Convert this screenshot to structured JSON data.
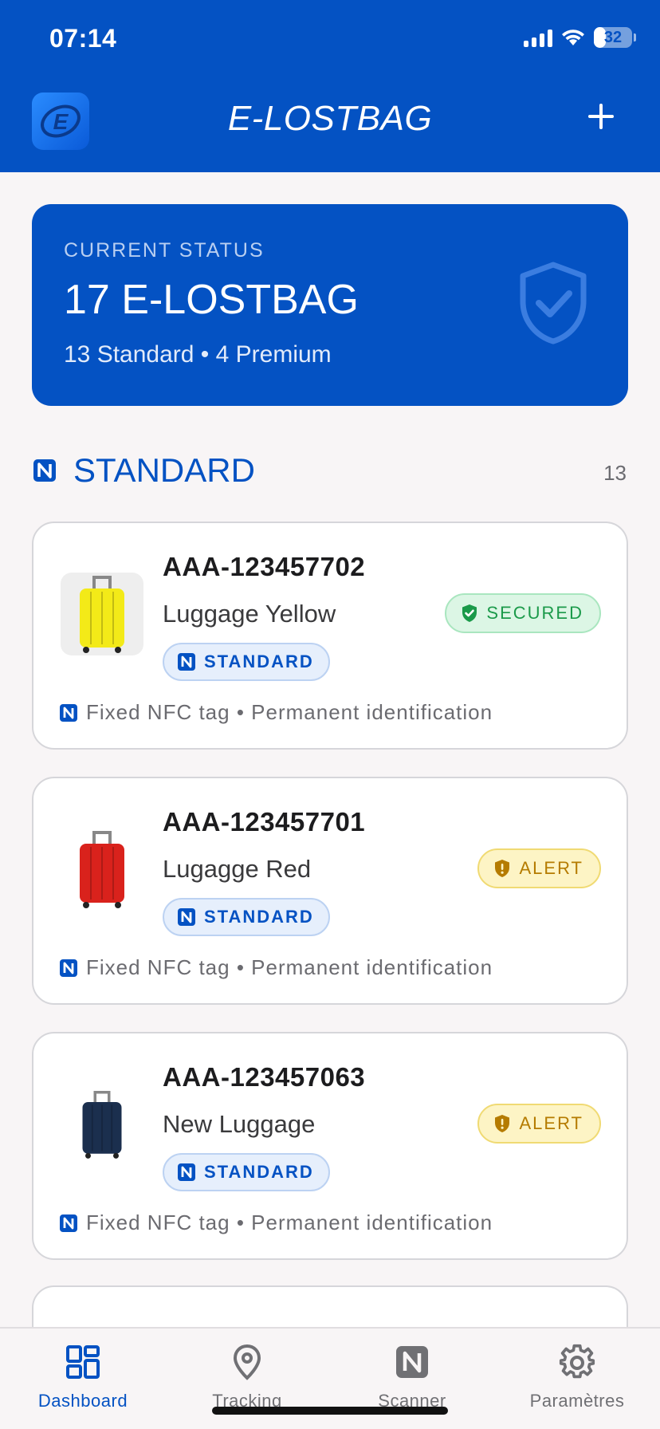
{
  "status_bar": {
    "time": "07:14",
    "battery": "32",
    "battery_level": 0.32
  },
  "header": {
    "title": "E-LOSTBAG",
    "logo_letter": "E"
  },
  "status_card": {
    "label": "CURRENT STATUS",
    "count_text": "17 E-LOSTBAG",
    "breakdown": "13 Standard • 4 Premium"
  },
  "section": {
    "title": "STANDARD",
    "count": "13"
  },
  "items": [
    {
      "code": "AAA-123457702",
      "name": "Luggage Yellow",
      "tier": "STANDARD",
      "status": "SECURED",
      "status_type": "secured",
      "footer": "Fixed NFC tag • Permanent identification",
      "color": "#f3ea18"
    },
    {
      "code": "AAA-123457701",
      "name": "Lugagge Red",
      "tier": "STANDARD",
      "status": "ALERT",
      "status_type": "alert",
      "footer": "Fixed NFC tag • Permanent identification",
      "color": "#d9221c"
    },
    {
      "code": "AAA-123457063",
      "name": "New Luggage",
      "tier": "STANDARD",
      "status": "ALERT",
      "status_type": "alert",
      "footer": "Fixed NFC tag • Permanent identification",
      "color": "#1b2f4e"
    }
  ],
  "nav": [
    {
      "label": "Dashboard",
      "icon": "dashboard-icon",
      "active": true
    },
    {
      "label": "Tracking",
      "icon": "location-pin-icon",
      "active": false
    },
    {
      "label": "Scanner",
      "icon": "nfc-icon",
      "active": false
    },
    {
      "label": "Paramètres",
      "icon": "gear-icon",
      "active": false
    }
  ],
  "colors": {
    "primary": "#0452c3",
    "secured": "#1b9a4a",
    "alert": "#b57b00"
  }
}
